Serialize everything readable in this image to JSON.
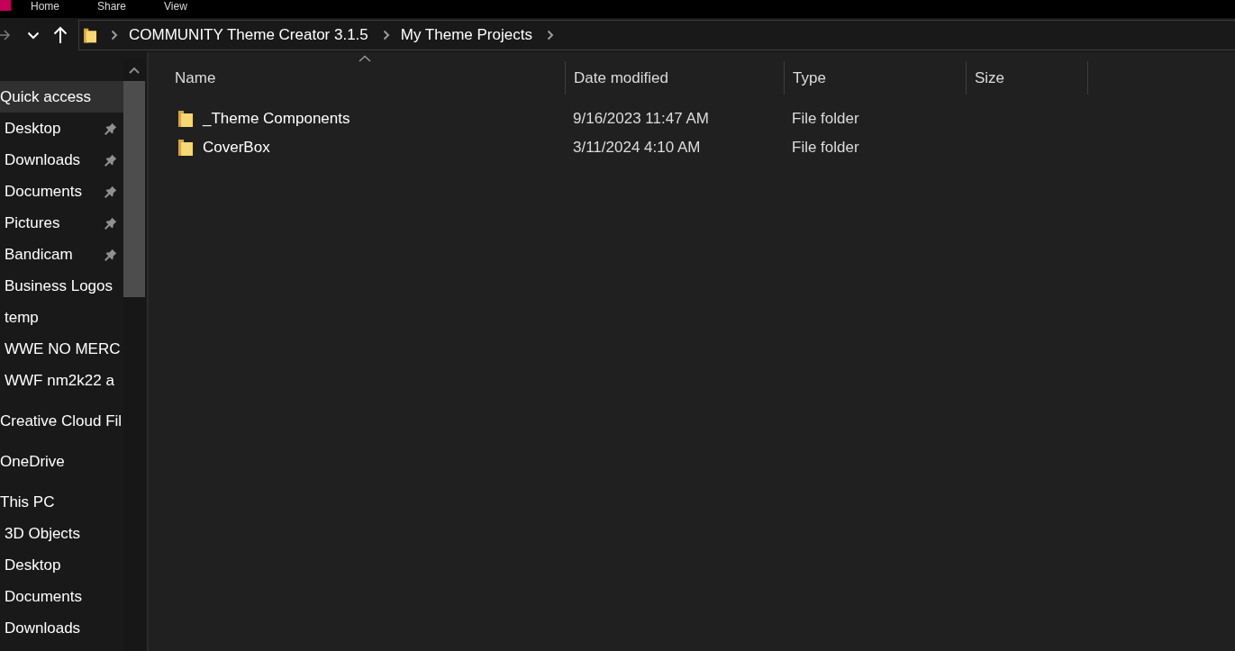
{
  "ribbon": {
    "tabs": [
      "Home",
      "Share",
      "View"
    ]
  },
  "address_bar": {
    "crumbs": [
      "COMMUNITY Theme Creator 3.1.5",
      "My Theme Projects"
    ]
  },
  "sidebar": {
    "sections": [
      {
        "label": "Quick access",
        "selected": true,
        "children": [
          {
            "label": "Desktop",
            "pinned": true,
            "selected": false
          },
          {
            "label": "Downloads",
            "pinned": true,
            "selected": false
          },
          {
            "label": "Documents",
            "pinned": true,
            "selected": false
          },
          {
            "label": "Pictures",
            "pinned": true,
            "selected": false
          },
          {
            "label": "Bandicam",
            "pinned": true,
            "selected": false
          },
          {
            "label": "Business Logos",
            "pinned": false,
            "selected": false
          },
          {
            "label": "temp",
            "pinned": false,
            "selected": false
          },
          {
            "label": "WWE NO MERC",
            "pinned": false,
            "selected": false
          },
          {
            "label": "WWF nm2k22 a",
            "pinned": false,
            "selected": false
          }
        ]
      },
      {
        "label": "Creative Cloud Fil",
        "selected": false
      },
      {
        "label": "OneDrive",
        "selected": false
      },
      {
        "label": "This PC",
        "selected": false,
        "children": [
          {
            "label": "3D Objects",
            "pinned": false,
            "selected": false
          },
          {
            "label": "Desktop",
            "pinned": false,
            "selected": false
          },
          {
            "label": "Documents",
            "pinned": false,
            "selected": false
          },
          {
            "label": "Downloads",
            "pinned": false,
            "selected": false
          }
        ]
      }
    ]
  },
  "file_list": {
    "columns": [
      {
        "label": "Name",
        "sorted": true
      },
      {
        "label": "Date modified",
        "sorted": false
      },
      {
        "label": "Type",
        "sorted": false
      },
      {
        "label": "Size",
        "sorted": false
      }
    ],
    "rows": [
      {
        "name": "_Theme Components",
        "date_modified": "9/16/2023 11:47 AM",
        "type": "File folder"
      },
      {
        "name": "CoverBox",
        "date_modified": "3/11/2024 4:10 AM",
        "type": "File folder"
      }
    ]
  }
}
